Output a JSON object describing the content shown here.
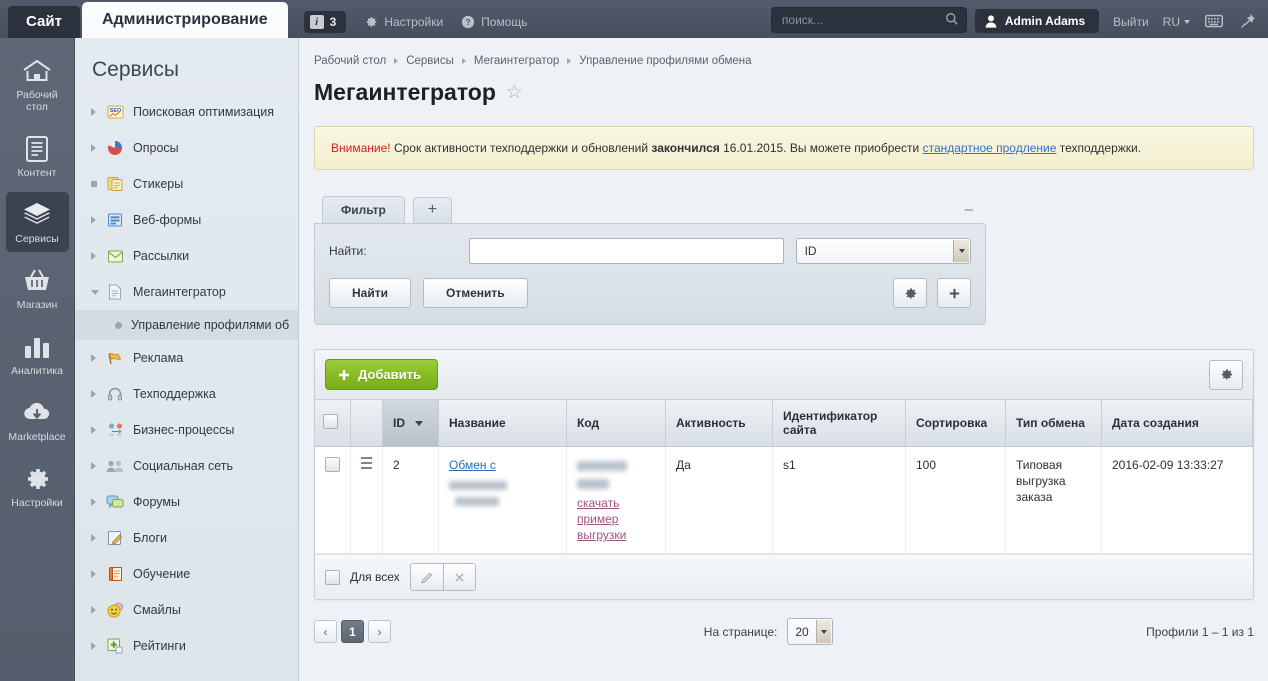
{
  "topbar": {
    "site_tab": "Сайт",
    "admin_tab": "Администрирование",
    "notification_count": "3",
    "settings_label": "Настройки",
    "help_label": "Помощь",
    "search_placeholder": "поиск...",
    "user_name": "Admin Adams",
    "logout_label": "Выйти",
    "language": "RU",
    "icons": {
      "info": "info-icon",
      "gear": "gear-icon",
      "help": "question-icon",
      "search": "search-icon",
      "user": "user-icon",
      "keyboard": "keyboard-icon",
      "pin": "pin-icon"
    }
  },
  "rail": {
    "items": [
      {
        "label": "Рабочий стол",
        "icon": "home-icon",
        "active": false
      },
      {
        "label": "Контент",
        "icon": "document-icon",
        "active": false
      },
      {
        "label": "Сервисы",
        "icon": "layers-icon",
        "active": true
      },
      {
        "label": "Магазин",
        "icon": "basket-icon",
        "active": false
      },
      {
        "label": "Аналитика",
        "icon": "bar-chart-icon",
        "active": false
      },
      {
        "label": "Marketplace",
        "icon": "cloud-download-icon",
        "active": false
      },
      {
        "label": "Настройки",
        "icon": "gear-icon",
        "active": false
      }
    ]
  },
  "sidebar": {
    "title": "Сервисы",
    "items": [
      {
        "label": "Поисковая оптимизация",
        "icon": "seo-icon",
        "state": "collapsed"
      },
      {
        "label": "Опросы",
        "icon": "pie-chart-icon",
        "state": "collapsed"
      },
      {
        "label": "Стикеры",
        "icon": "stickers-icon",
        "state": "leaf"
      },
      {
        "label": "Веб-формы",
        "icon": "webform-icon",
        "state": "collapsed"
      },
      {
        "label": "Рассылки",
        "icon": "mail-icon",
        "state": "collapsed"
      },
      {
        "label": "Мегаинтегратор",
        "icon": "page-icon",
        "state": "expanded"
      },
      {
        "label": "Реклама",
        "icon": "flag-icon",
        "state": "collapsed"
      },
      {
        "label": "Техподдержка",
        "icon": "headset-icon",
        "state": "collapsed"
      },
      {
        "label": "Бизнес-процессы",
        "icon": "workflow-icon",
        "state": "collapsed"
      },
      {
        "label": "Социальная сеть",
        "icon": "people-icon",
        "state": "collapsed"
      },
      {
        "label": "Форумы",
        "icon": "chat-icon",
        "state": "collapsed"
      },
      {
        "label": "Блоги",
        "icon": "pencil-note-icon",
        "state": "collapsed"
      },
      {
        "label": "Обучение",
        "icon": "book-icon",
        "state": "collapsed"
      },
      {
        "label": "Смайлы",
        "icon": "smiley-icon",
        "state": "collapsed"
      },
      {
        "label": "Рейтинги",
        "icon": "rating-icon",
        "state": "collapsed"
      }
    ],
    "sub_item": "Управление профилями об"
  },
  "breadcrumb": [
    "Рабочий стол",
    "Сервисы",
    "Мегаинтегратор",
    "Управление профилями обмена"
  ],
  "page": {
    "title": "Мегаинтегратор",
    "favorite_icon": "star-icon"
  },
  "warning": {
    "attention": "Внимание!",
    "text_before": " Срок активности техподдержки и обновлений ",
    "bold": "закончился",
    "text_middle": " 16.01.2015. Вы можете приобрести ",
    "link": "стандартное продление",
    "text_after": " техподдержки."
  },
  "filter": {
    "tab_label": "Фильтр",
    "add_tab_label": "+",
    "collapse_label": "–",
    "find_label": "Найти:",
    "find_value": "",
    "field_select": "ID",
    "search_button": "Найти",
    "cancel_button": "Отменить",
    "settings_icon": "gear-icon",
    "add_icon": "plus-icon"
  },
  "grid": {
    "add_button": "Добавить",
    "settings_icon": "gear-icon",
    "columns": [
      "ID",
      "Название",
      "Код",
      "Активность",
      "Идентификатор сайта",
      "Сортировка",
      "Тип обмена",
      "Дата создания"
    ],
    "sorted_column": "ID",
    "sort_direction": "desc",
    "rows": [
      {
        "id": "2",
        "name": "Обмен с",
        "name_redacted": true,
        "code_redacted": true,
        "code_links": [
          "скачать",
          "пример",
          "выгрузки"
        ],
        "active": "Да",
        "site_id": "s1",
        "sort": "100",
        "exchange_type": "Типовая выгрузка заказа",
        "created": "2016-02-09 13:33:27"
      }
    ],
    "footer": {
      "select_all_label": "Для всех",
      "edit_icon": "pencil-icon",
      "delete_icon": "close-icon"
    }
  },
  "pagination": {
    "prev": "‹",
    "current_page": "1",
    "next": "›",
    "per_page_label": "На странице:",
    "per_page_value": "20",
    "summary": "Профили 1 – 1 из 1"
  },
  "colors": {
    "topbar": "#4b5463",
    "rail": "#5b6472",
    "sidebar": "#e2e9ee",
    "accent_green": "#8cc026",
    "link_blue": "#2f6cb5",
    "warning_bg": "#f7f3d8",
    "warning_red": "#d4201f"
  }
}
